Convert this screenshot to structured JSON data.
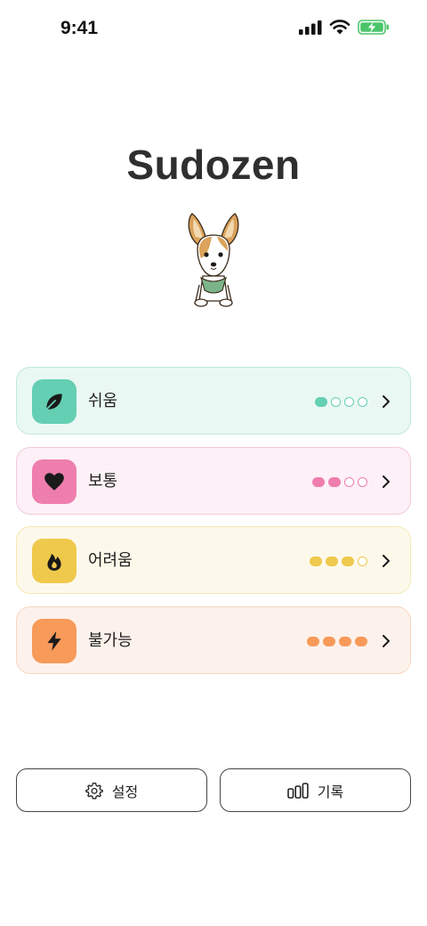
{
  "status_bar": {
    "time": "9:41"
  },
  "app": {
    "title": "Sudozen"
  },
  "levels": [
    {
      "label": "쉬움",
      "icon": "leaf-icon",
      "filled": 1,
      "total": 4,
      "bg": "#eaf8f3",
      "border": "#bfe9dc",
      "icon_bg": "#64cfb3",
      "dot": "#64cfb3"
    },
    {
      "label": "보통",
      "icon": "heart-icon",
      "filled": 2,
      "total": 4,
      "bg": "#fdf0f6",
      "border": "#f5c9dd",
      "icon_bg": "#ee7eae",
      "dot": "#ee7eae"
    },
    {
      "label": "어려움",
      "icon": "flame-icon",
      "filled": 3,
      "total": 4,
      "bg": "#fdf9ea",
      "border": "#f5e8b5",
      "icon_bg": "#efc94c",
      "dot": "#efc94c"
    },
    {
      "label": "불가능",
      "icon": "lightning-icon",
      "filled": 4,
      "total": 4,
      "bg": "#fdf2eb",
      "border": "#f8d6c1",
      "icon_bg": "#f79a5a",
      "dot": "#f79a5a"
    }
  ],
  "buttons": {
    "settings_label": "설정",
    "records_label": "기록"
  }
}
